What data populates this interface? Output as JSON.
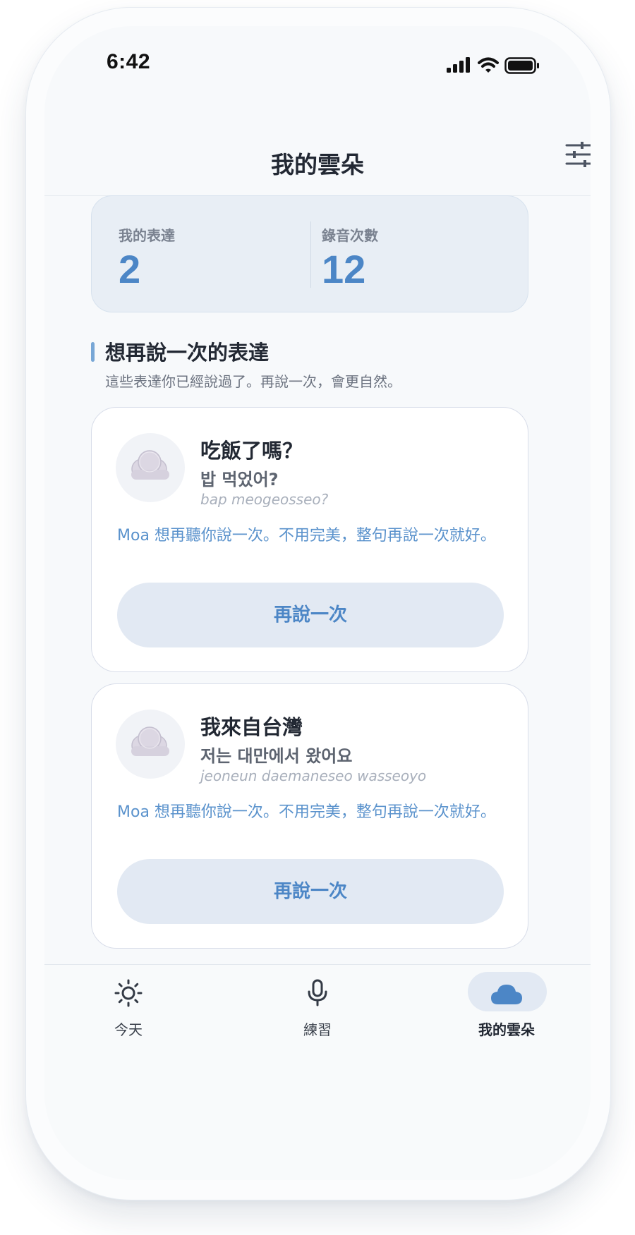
{
  "status_bar": {
    "time": "6:42"
  },
  "header": {
    "title": "我的雲朵",
    "filter_icon": "sliders-icon"
  },
  "stats": {
    "expressions_label": "我的表達",
    "expressions_value": "2",
    "recordings_label": "錄音次數",
    "recordings_value": "12"
  },
  "section": {
    "title": "想再說一次的表達",
    "subtitle": "這些表達你已經說過了。再說一次，會更自然。"
  },
  "phrases": [
    {
      "zh": "吃飯了嗎？",
      "ko": "밥 먹었어?",
      "roman": "bap meogeosseo?",
      "note": "Moa 想再聽你說一次。不用完美，整句再說一次就好。",
      "button": "再說一次"
    },
    {
      "zh": "我來自台灣",
      "ko": "저는 대만에서 왔어요",
      "roman": "jeoneun daemaneseo wasseoyo",
      "note": "Moa 想再聽你說一次。不用完美，整句再說一次就好。",
      "button": "再說一次"
    }
  ],
  "tabs": [
    {
      "label": "今天",
      "icon": "sun-icon"
    },
    {
      "label": "練習",
      "icon": "microphone-icon"
    },
    {
      "label": "我的雲朵",
      "icon": "cloud-icon",
      "active": true
    }
  ],
  "colors": {
    "accent": "#4c86c6",
    "accent_soft": "#e2e9f3",
    "text_dark": "#222833"
  }
}
